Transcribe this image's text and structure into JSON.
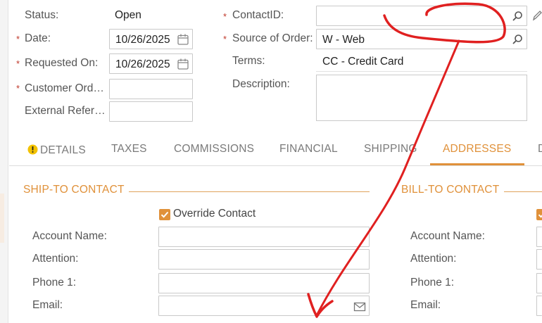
{
  "header": {
    "status_label": "Status:",
    "status_value": "Open",
    "date_label": "Date:",
    "date_value": "10/26/2025",
    "requested_label": "Requested On:",
    "requested_value": "10/26/2025",
    "customer_order_label": "Customer Ord…",
    "customer_order_value": "",
    "external_ref_label": "External Refer…",
    "external_ref_value": "",
    "contact_label": "ContactID:",
    "contact_value": "",
    "source_label": "Source of Order:",
    "source_value": "W - Web",
    "terms_label": "Terms:",
    "terms_value": "CC - Credit Card",
    "description_label": "Description:",
    "description_value": "",
    "required_marker": "*"
  },
  "tabs": [
    {
      "label": "DETAILS",
      "active": false,
      "warning": true
    },
    {
      "label": "TAXES",
      "active": false
    },
    {
      "label": "COMMISSIONS",
      "active": false
    },
    {
      "label": "FINANCIAL",
      "active": false
    },
    {
      "label": "SHIPPING",
      "active": false
    },
    {
      "label": "ADDRESSES",
      "active": true
    },
    {
      "label": "D",
      "active": false
    }
  ],
  "ship_to": {
    "title": "SHIP-TO CONTACT",
    "override_label": "Override Contact",
    "override_checked": true,
    "account_name_label": "Account Name:",
    "account_name_value": "",
    "attention_label": "Attention:",
    "attention_value": "",
    "phone_label": "Phone 1:",
    "phone_value": "",
    "email_label": "Email:",
    "email_value": ""
  },
  "bill_to": {
    "title": "BILL-TO CONTACT",
    "override_checked": true,
    "account_name_label": "Account Name:",
    "attention_label": "Attention:",
    "phone_label": "Phone 1:",
    "email_label": "Email:"
  },
  "icons": {
    "calendar": "calendar-icon",
    "search": "search-icon",
    "edit": "pencil-icon",
    "mail": "mail-icon",
    "warning": "warning-icon"
  },
  "colors": {
    "accent": "#e0913a",
    "required": "#c0392b",
    "annotation": "#e02020",
    "warning": "#f2c200"
  }
}
